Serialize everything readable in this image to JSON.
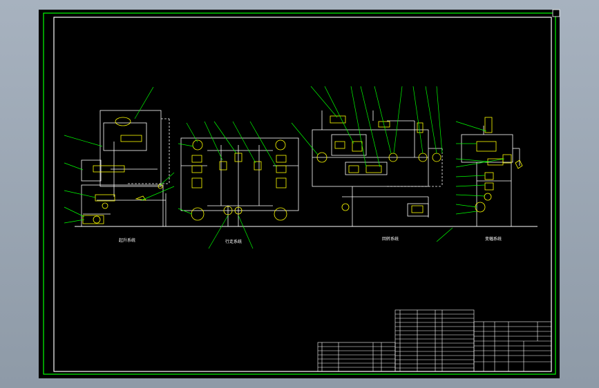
{
  "drawing": {
    "sections": [
      {
        "key": "s1",
        "label": "起升系统"
      },
      {
        "key": "s2",
        "label": "行走系统"
      },
      {
        "key": "s3",
        "label": "回转系统"
      },
      {
        "key": "s4",
        "label": "变幅系统"
      }
    ],
    "colors": {
      "background": "#000000",
      "frame": "#00ff00",
      "lines": "#ffffff",
      "leaders": "#00ff00",
      "components": "#ffff00",
      "outer": "#9aa6b3"
    }
  }
}
